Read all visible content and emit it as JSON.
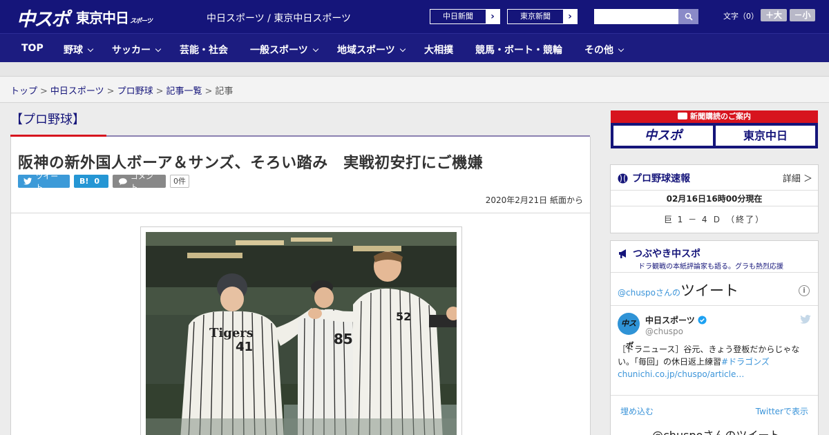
{
  "header": {
    "logo_main": "中スポ",
    "logo_tokyo": "東京中日",
    "logo_tokyo_sub": "スポーツ",
    "site_links": "中日スポーツ / 東京中日スポーツ",
    "newspaper_buttons": [
      "中日新聞",
      "東京新聞"
    ],
    "search_placeholder": "",
    "font_size_label": "文字（0）",
    "font_larger": "＋大",
    "font_smaller": "－小"
  },
  "nav": {
    "items": [
      {
        "label": "TOP",
        "dropdown": false
      },
      {
        "label": "野球",
        "dropdown": true
      },
      {
        "label": "サッカー",
        "dropdown": true
      },
      {
        "label": "芸能・社会",
        "dropdown": false
      },
      {
        "label": "一般スポーツ",
        "dropdown": true
      },
      {
        "label": "地域スポーツ",
        "dropdown": true
      },
      {
        "label": "大相撲",
        "dropdown": false
      },
      {
        "label": "競馬・ボート・競輪",
        "dropdown": false
      },
      {
        "label": "その他",
        "dropdown": true
      }
    ]
  },
  "breadcrumb": {
    "items": [
      "トップ",
      "中日スポーツ",
      "プロ野球",
      "記事一覧"
    ],
    "current": "記事",
    "separator": ">"
  },
  "article": {
    "category": "【プロ野球】",
    "title": "阪神の新外国人ボーア＆サンズ、そろい踏み　実戦初安打にご機嫌",
    "tweet_label": "ツイート",
    "hatena_label": "B!",
    "hatena_count": "0",
    "comment_label": "コメント",
    "comment_count": "0件",
    "date": "2020年2月21日 紙面から",
    "photo_jersey_text": "Tigers",
    "photo_numbers": [
      "41",
      "85",
      "52"
    ]
  },
  "sidebar": {
    "subscribe_title": "新聞購読のご案内",
    "subscribe_logos": [
      "中スポ",
      "東京中日"
    ],
    "scoreboard": {
      "title": "プロ野球速報",
      "detail": "詳細 ＞",
      "as_of": "02月16日16時00分現在",
      "game": "巨 1 － 4 Ｄ （終了）"
    },
    "tweets": {
      "title": "つぶやき中スポ",
      "subtitle": "ドラ観戦の本紙評論家も語る。グラも熱烈応援",
      "widget_prefix": "@chuspoさんの",
      "widget_title": "ツイート",
      "account_name": "中日スポーツ",
      "account_handle": "@chuspo",
      "avatar_text": "中スポ",
      "tweet_text": "［ドラニュース］谷元、きょう登板だからじゃない。「毎回」の休日返上練習",
      "tweet_hashtag": "#ドラゴンズ",
      "tweet_link": "chunichi.co.jp/chuspo/article…",
      "embed_label": "埋め込む",
      "view_on_twitter": "Twitterで表示",
      "more_label": "@chuspoさんのツイート"
    }
  },
  "colors": {
    "brand_navy": "#15157a",
    "accent_red": "#d7141e",
    "twitter_blue": "#3b94d9"
  }
}
